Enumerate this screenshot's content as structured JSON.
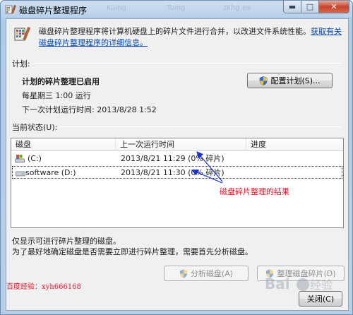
{
  "window": {
    "title": "磁盘碎片整理程序",
    "ghost_tabs": [
      "Kuing",
      "Tuing",
      "zkhg.ea"
    ]
  },
  "intro": {
    "text": "磁盘碎片整理程序将计算机硬盘上的碎片文件进行合并，以改进文件系统性能。",
    "link": "获取有关磁盘碎片整理程序的详细信息。"
  },
  "schedule": {
    "section_label": "计划:",
    "status": "计划的碎片整理已启用",
    "runs": "每星期三 1:00 运行",
    "next_run": "下一次计划运行时间: 2013/8/28 1:52",
    "configure_button": "配置计划(S)..."
  },
  "current_status": {
    "section_label": "当前状态(U):",
    "columns": [
      "磁盘",
      "上一次运行时间",
      "进度"
    ],
    "rows": [
      {
        "disk": "(C:)",
        "last_run": "2013/8/21 11:29 (0% 碎片)",
        "progress": ""
      },
      {
        "disk": "software (D:)",
        "last_run": "2013/8/21 11:30 (0% 碎片)",
        "progress": ""
      }
    ]
  },
  "annotation": "磁盘碎片整理的结果",
  "notes": {
    "line1": "仅显示可进行碎片整理的磁盘。",
    "line2": "为了最好地确定磁盘是否需要立即进行碎片整理，需要首先分析磁盘。"
  },
  "buttons": {
    "analyze": "分析磁盘(A)",
    "defrag": "整理磁盘碎片(D)",
    "close": "关闭(C)"
  },
  "watermark": "百度经验：xyh666168",
  "colors": {
    "link": "#0645ad",
    "annotation": "#e0152a",
    "arrow": "#1a2fd6"
  },
  "icons": {
    "title": "defrag-icon",
    "intro": "defrag-icon",
    "shield": "uac-shield-icon",
    "c_drive": "system-drive-icon",
    "d_drive": "drive-icon"
  }
}
